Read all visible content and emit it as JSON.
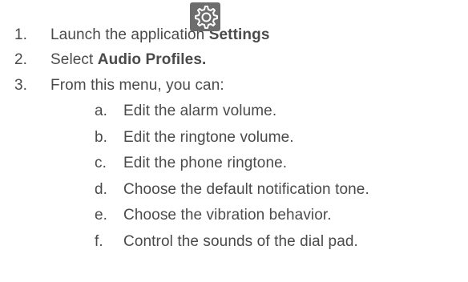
{
  "steps": [
    {
      "num": "1.",
      "text": "Launch the application ",
      "bold": "Settings",
      "after": "."
    },
    {
      "num": "2.",
      "text": "Select ",
      "bold": "Audio Profiles."
    },
    {
      "num": "3.",
      "text": "From this menu, you can:"
    }
  ],
  "substeps": [
    {
      "num": "a.",
      "text": "Edit the alarm volume."
    },
    {
      "num": "b.",
      "text": "Edit the ringtone volume."
    },
    {
      "num": "c.",
      "text": "Edit the phone ringtone."
    },
    {
      "num": "d.",
      "text": "Choose the default notification tone."
    },
    {
      "num": "e.",
      "text": "Choose the vibration behavior."
    },
    {
      "num": "f.",
      "text": "Control the sounds of the dial pad."
    }
  ],
  "icons": {
    "settings": "settings-gear-icon"
  }
}
